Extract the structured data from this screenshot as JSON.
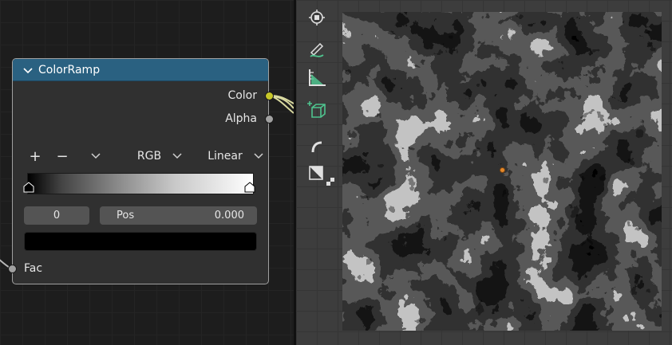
{
  "node": {
    "title": "ColorRamp",
    "outputs": {
      "color": "Color",
      "alpha": "Alpha"
    },
    "inputs": {
      "fac": "Fac"
    },
    "toolbar": {
      "add": "+",
      "remove": "−",
      "color_mode": "RGB",
      "interpolation": "Linear"
    },
    "stop_index": "0",
    "pos_label": "Pos",
    "pos_value": "0.000",
    "selected_stop_color": "#000000"
  },
  "colors": {
    "header": "#2a6181",
    "color_socket": "#c7c729",
    "gray_socket": "#a1a1a1",
    "origin": "#e5892b"
  },
  "viewport": {
    "tools": [
      "cursor-tool-icon",
      "annotate-tool-icon",
      "measure-tool-icon",
      "add-cube-tool-icon",
      "curve-tool-icon",
      "transform-tool-icon"
    ]
  }
}
